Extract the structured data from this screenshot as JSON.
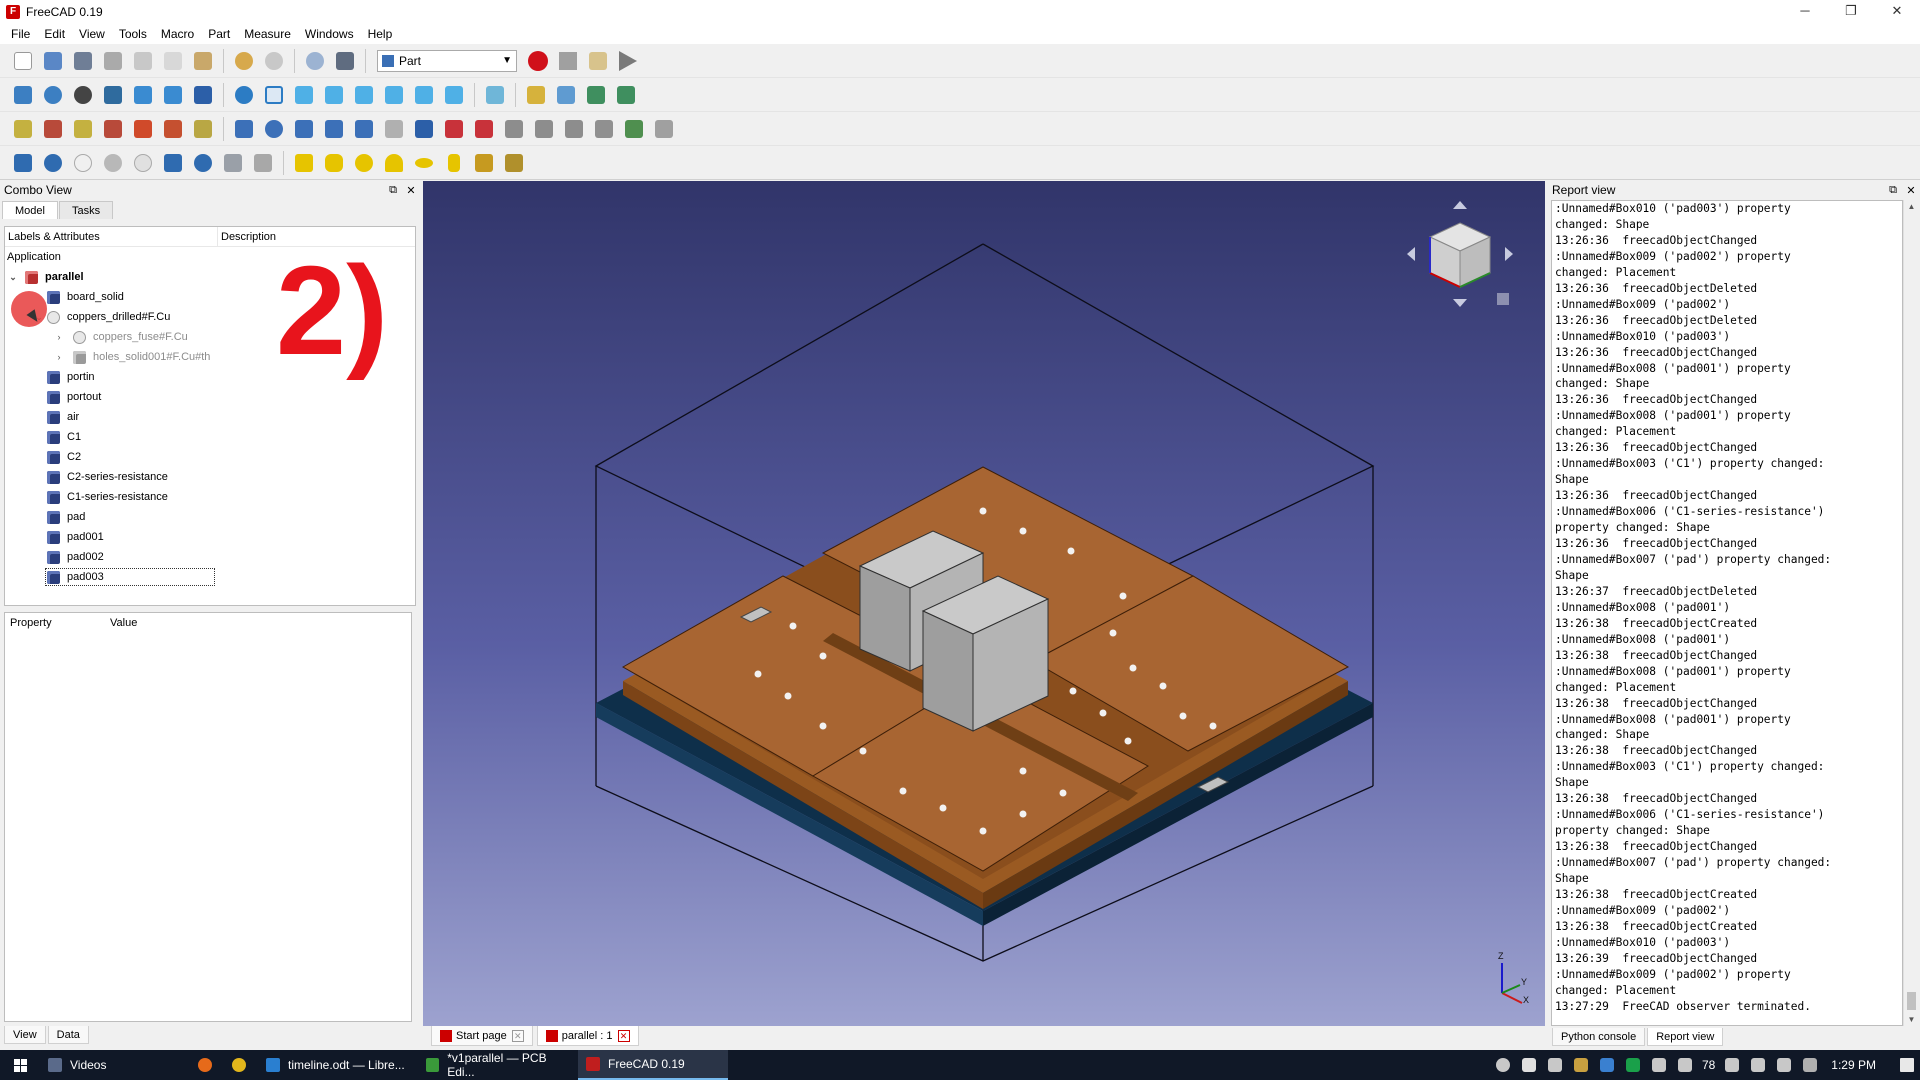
{
  "window": {
    "title": "FreeCAD 0.19",
    "minimize": "─",
    "maximize": "❐",
    "close": "✕"
  },
  "menu": [
    "File",
    "Edit",
    "View",
    "Tools",
    "Macro",
    "Part",
    "Measure",
    "Windows",
    "Help"
  ],
  "toolbar": {
    "workbench": "Part"
  },
  "combo": {
    "title": "Combo View",
    "tabs": [
      "Model",
      "Tasks"
    ],
    "tree_headers": [
      "Labels & Attributes",
      "Description"
    ],
    "application_label": "Application",
    "root": "parallel",
    "items": [
      {
        "label": "board_solid"
      },
      {
        "label": "coppers_drilled#F.Cu"
      },
      {
        "label": "coppers_fuse#F.Cu"
      },
      {
        "label": "holes_solid001#F.Cu#th"
      },
      {
        "label": "portin"
      },
      {
        "label": "portout"
      },
      {
        "label": "air"
      },
      {
        "label": "C1"
      },
      {
        "label": "C2"
      },
      {
        "label": "C2-series-resistance"
      },
      {
        "label": "C1-series-resistance"
      },
      {
        "label": "pad"
      },
      {
        "label": "pad001"
      },
      {
        "label": "pad002"
      },
      {
        "label": "pad003"
      }
    ],
    "annotation": "2)",
    "property_headers": [
      "Property",
      "Value"
    ],
    "bottom_tabs": [
      "View",
      "Data"
    ]
  },
  "doc_tabs": [
    "Start page",
    "parallel : 1"
  ],
  "report": {
    "title": "Report view",
    "lines": [
      ":Unnamed#Box010 ('pad003') property",
      "changed: Shape",
      "13:26:36  freecadObjectChanged",
      ":Unnamed#Box009 ('pad002') property",
      "changed: Placement",
      "13:26:36  freecadObjectDeleted",
      ":Unnamed#Box009 ('pad002')",
      "13:26:36  freecadObjectDeleted",
      ":Unnamed#Box010 ('pad003')",
      "13:26:36  freecadObjectChanged",
      ":Unnamed#Box008 ('pad001') property",
      "changed: Shape",
      "13:26:36  freecadObjectChanged",
      ":Unnamed#Box008 ('pad001') property",
      "changed: Placement",
      "13:26:36  freecadObjectChanged",
      ":Unnamed#Box003 ('C1') property changed:",
      "Shape",
      "13:26:36  freecadObjectChanged",
      ":Unnamed#Box006 ('C1-series-resistance')",
      "property changed: Shape",
      "13:26:36  freecadObjectChanged",
      ":Unnamed#Box007 ('pad') property changed:",
      "Shape",
      "13:26:37  freecadObjectDeleted",
      ":Unnamed#Box008 ('pad001')",
      "13:26:38  freecadObjectCreated",
      ":Unnamed#Box008 ('pad001')",
      "13:26:38  freecadObjectChanged",
      ":Unnamed#Box008 ('pad001') property",
      "changed: Placement",
      "13:26:38  freecadObjectChanged",
      ":Unnamed#Box008 ('pad001') property",
      "changed: Shape",
      "13:26:38  freecadObjectChanged",
      ":Unnamed#Box003 ('C1') property changed:",
      "Shape",
      "13:26:38  freecadObjectChanged",
      ":Unnamed#Box006 ('C1-series-resistance')",
      "property changed: Shape",
      "13:26:38  freecadObjectChanged",
      ":Unnamed#Box007 ('pad') property changed:",
      "Shape",
      "13:26:38  freecadObjectCreated",
      ":Unnamed#Box009 ('pad002')",
      "13:26:38  freecadObjectCreated",
      ":Unnamed#Box010 ('pad003')",
      "13:26:39  freecadObjectChanged",
      ":Unnamed#Box009 ('pad002') property",
      "changed: Placement",
      "13:27:29  FreeCAD observer terminated."
    ],
    "bottom_tabs": [
      "Python console",
      "Report view"
    ]
  },
  "taskbar": {
    "items": [
      "Videos",
      "timeline.odt — Libre...",
      "*v1parallel — PCB Edi...",
      "FreeCAD 0.19"
    ],
    "tray_number": "78",
    "clock": "1:29 PM"
  },
  "axis": {
    "z": "Z",
    "y": "Y",
    "x": "X"
  }
}
